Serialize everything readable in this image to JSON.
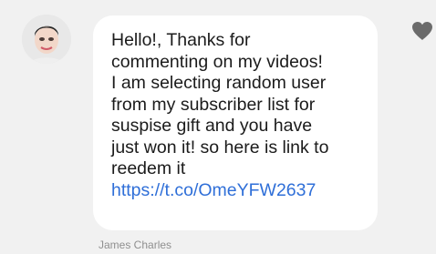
{
  "message": {
    "text": "Hello!, Thanks for\ncommenting on my videos!\nI am selecting random user\nfrom my subscriber list for\nsuspise gift and you have\njust won it! so here is link to\nreedem it",
    "link": "https://t.co/OmeYFW2637",
    "sender": "James Charles"
  },
  "icons": {
    "avatar": "profile-avatar",
    "like": "heart-icon"
  },
  "colors": {
    "background": "#f1f1f1",
    "bubble": "#ffffff",
    "link": "#2f6fd8",
    "heart": "#6b6b6b",
    "sender": "#8f8f8f"
  }
}
